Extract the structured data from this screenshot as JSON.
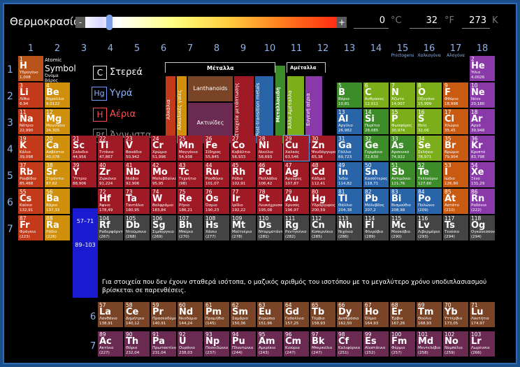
{
  "header": {
    "title": "Θερμοκρασία",
    "minus": "-",
    "plus": "+",
    "kelvin_val": "273",
    "celsius_val": "0",
    "fahrenheit_val": "32",
    "c_unit": "°C",
    "f_unit": "°F",
    "k_unit": "K"
  },
  "groups": [
    "1",
    "2",
    "3",
    "4",
    "5",
    "6",
    "7",
    "8",
    "9",
    "10",
    "11",
    "12",
    "13",
    "14",
    "15",
    "16",
    "17",
    "18"
  ],
  "group_sub": {
    "15": "Pnictogens",
    "16": "Χαλκογόνα",
    "17": "Αλογόνα"
  },
  "periods": [
    "1",
    "2",
    "3",
    "4",
    "5",
    "6",
    "7"
  ],
  "legend": {
    "atomic": "Atomic",
    "symbol": "Symbol",
    "name": "Όνομα",
    "weight": "Βάρος",
    "solid": "Στερεά",
    "liquid": "Υγρά",
    "gas": "Αέρια",
    "unknown": "Άγνωστα",
    "solid_sym": "C",
    "liquid_sym": "Hg",
    "gas_sym": "H",
    "unknown_sym": "Rf"
  },
  "cat_labels": {
    "metals": "Μέταλλα",
    "metalloids": "Μεταλλοειδή",
    "nonmetals": "Αμέταλλα",
    "alkali": "Αλκάλια",
    "alkaline": "Αλκαλικές γαίες",
    "lanthanoids": "Lanthanoids",
    "actinides": "Ακτινίδες",
    "transition": "Στοιχεία μετάπτωσης",
    "post_transition": "Post-transition metals",
    "other_nonmetals": "Άλλα Αμέταλλα",
    "noble": "Ευγενή αέρια"
  },
  "ranges": {
    "lan": "57–71",
    "act": "89–103"
  },
  "note": "Για στοιχεία που δεν έχουν σταθερά ισότοπα, ο μαζικός αριθμός του ισοτόπου με το μεγαλύτερο χρόνο υποδιπλασιασμού βρίσκεται σε παρενθέσεις.",
  "lan_label": "6",
  "act_label": "7",
  "elements": [
    [
      "1",
      "H",
      "Υδρογόνο",
      "1,008",
      1,
      1,
      "h"
    ],
    [
      "2",
      "He",
      "Ήλιο",
      "4.0026",
      1,
      18,
      "nob"
    ],
    [
      "3",
      "Li",
      "Λίθιο",
      "6,94",
      2,
      1,
      "alk"
    ],
    [
      "4",
      "Be",
      "Βηρύλλιο",
      "9,0122",
      2,
      2,
      "ae"
    ],
    [
      "5",
      "B",
      "Βόριο",
      "10,81",
      2,
      13,
      "met"
    ],
    [
      "6",
      "C",
      "Άνθρακας",
      "12,011",
      2,
      14,
      "non"
    ],
    [
      "7",
      "N",
      "Άζωτο",
      "14,007",
      2,
      15,
      "non"
    ],
    [
      "8",
      "O",
      "Οξυγόνο",
      "15,999",
      2,
      16,
      "non"
    ],
    [
      "9",
      "F",
      "Φθόριο",
      "18,998",
      2,
      17,
      "hal"
    ],
    [
      "10",
      "Ne",
      "Νέον",
      "20,180",
      2,
      18,
      "nob"
    ],
    [
      "11",
      "Na",
      "Νάτριο",
      "22,990",
      3,
      1,
      "alk"
    ],
    [
      "12",
      "Mg",
      "Μαγνήσιο",
      "24,305",
      3,
      2,
      "ae"
    ],
    [
      "13",
      "Al",
      "Αργίλιο",
      "26,982",
      3,
      13,
      "ptm"
    ],
    [
      "14",
      "Si",
      "Πυρίτιο",
      "28,085",
      3,
      14,
      "met"
    ],
    [
      "15",
      "P",
      "Φωσφόρος",
      "30,974",
      3,
      15,
      "non"
    ],
    [
      "16",
      "S",
      "Θείο",
      "32,06",
      3,
      16,
      "non"
    ],
    [
      "17",
      "Cl",
      "Χλώριο",
      "35,45",
      3,
      17,
      "hal"
    ],
    [
      "18",
      "Ar",
      "Αργό",
      "39,948",
      3,
      18,
      "nob"
    ],
    [
      "19",
      "K",
      "Κάλιο",
      "39,098",
      4,
      1,
      "alk"
    ],
    [
      "20",
      "Ca",
      "Ασβέστιο",
      "40,078",
      4,
      2,
      "ae"
    ],
    [
      "21",
      "Sc",
      "Σκάνδιο",
      "44,956",
      4,
      3,
      "tm"
    ],
    [
      "22",
      "Ti",
      "Τιτάνιο",
      "47,867",
      4,
      4,
      "tm"
    ],
    [
      "23",
      "V",
      "Βανάδιο",
      "50,942",
      4,
      5,
      "tm"
    ],
    [
      "24",
      "Cr",
      "Χρώμιο",
      "51,996",
      4,
      6,
      "tm"
    ],
    [
      "25",
      "Mn",
      "Μαγγάνιο",
      "54,938",
      4,
      7,
      "tm"
    ],
    [
      "26",
      "Fe",
      "Σίδηρος",
      "55,845",
      4,
      8,
      "tm"
    ],
    [
      "27",
      "Co",
      "Κοβάλτιο",
      "58,933",
      4,
      9,
      "tm"
    ],
    [
      "28",
      "Ni",
      "Νικέλιο",
      "58,693",
      4,
      10,
      "tm"
    ],
    [
      "29",
      "Cu",
      "Χαλκός",
      "63,546",
      4,
      11,
      "tm"
    ],
    [
      "30",
      "Zn",
      "Ψευδάργυρος",
      "65,38",
      4,
      12,
      "tm"
    ],
    [
      "31",
      "Ga",
      "Γάλλιο",
      "69,723",
      4,
      13,
      "ptm"
    ],
    [
      "32",
      "Ge",
      "Γερμάνιο",
      "72,630",
      4,
      14,
      "met"
    ],
    [
      "33",
      "As",
      "Αρσενικό",
      "74,922",
      4,
      15,
      "met"
    ],
    [
      "34",
      "Se",
      "Σελήνιο",
      "78,971",
      4,
      16,
      "non"
    ],
    [
      "35",
      "Br",
      "Βρώμιο",
      "79,904",
      4,
      17,
      "hal"
    ],
    [
      "36",
      "Kr",
      "Κρυπτό",
      "83,798",
      4,
      18,
      "nob"
    ],
    [
      "37",
      "Rb",
      "Ρουβίδιο",
      "85,468",
      5,
      1,
      "alk"
    ],
    [
      "38",
      "Sr",
      "Στρόντιο",
      "87,62",
      5,
      2,
      "ae"
    ],
    [
      "39",
      "Y",
      "Ύττριο",
      "88,906",
      5,
      3,
      "tm"
    ],
    [
      "40",
      "Zr",
      "Ζιρκόνιο",
      "91,224",
      5,
      4,
      "tm"
    ],
    [
      "41",
      "Nb",
      "Νιόβιο",
      "92,906",
      5,
      5,
      "tm"
    ],
    [
      "42",
      "Mo",
      "Μολυβδαίνιο",
      "95,95",
      5,
      6,
      "tm"
    ],
    [
      "43",
      "Tc",
      "Τεχνήτιο",
      "(98)",
      5,
      7,
      "tm"
    ],
    [
      "44",
      "Ru",
      "Ρουθήνιο",
      "101,07",
      5,
      8,
      "tm"
    ],
    [
      "45",
      "Rh",
      "Ρόδιο",
      "102,91",
      5,
      9,
      "tm"
    ],
    [
      "46",
      "Pd",
      "Παλλάδιο",
      "106,42",
      5,
      10,
      "tm"
    ],
    [
      "47",
      "Ag",
      "Άργυρος",
      "107,87",
      5,
      11,
      "tm"
    ],
    [
      "48",
      "Cd",
      "Κάδμιο",
      "112,41",
      5,
      12,
      "tm"
    ],
    [
      "49",
      "In",
      "Ίνδιο",
      "114,82",
      5,
      13,
      "ptm"
    ],
    [
      "50",
      "Sn",
      "Κασσίτερος",
      "118,71",
      5,
      14,
      "ptm"
    ],
    [
      "51",
      "Sb",
      "Αντιμόνιο",
      "121,76",
      5,
      15,
      "met"
    ],
    [
      "52",
      "Te",
      "Τελλούριο",
      "127,60",
      5,
      16,
      "met"
    ],
    [
      "53",
      "I",
      "Ιώδιο",
      "126,90",
      5,
      17,
      "hal"
    ],
    [
      "54",
      "Xe",
      "Ξένο",
      "131,29",
      5,
      18,
      "nob"
    ],
    [
      "55",
      "Cs",
      "Καίσιο",
      "132,91",
      6,
      1,
      "alk"
    ],
    [
      "56",
      "Ba",
      "Βάριο",
      "137,33",
      6,
      2,
      "ae"
    ],
    [
      "72",
      "Hf",
      "Άφνιο",
      "178,49",
      6,
      4,
      "tm"
    ],
    [
      "73",
      "Ta",
      "Ταντάλιο",
      "180,95",
      6,
      5,
      "tm"
    ],
    [
      "74",
      "W",
      "Βολφράμιο",
      "183,84",
      6,
      6,
      "tm"
    ],
    [
      "75",
      "Re",
      "Ρήνιο",
      "186,21",
      6,
      7,
      "tm"
    ],
    [
      "76",
      "Os",
      "Όσμιο",
      "190,23",
      6,
      8,
      "tm"
    ],
    [
      "77",
      "Ir",
      "Ιρίδιο",
      "192,22",
      6,
      9,
      "tm"
    ],
    [
      "78",
      "Pt",
      "Λευκόχρυσος",
      "195,08",
      6,
      10,
      "tm"
    ],
    [
      "79",
      "Au",
      "Χρυσός",
      "196,97",
      6,
      11,
      "tm"
    ],
    [
      "80",
      "Hg",
      "Υδράργυρος",
      "200,59",
      6,
      12,
      "tm"
    ],
    [
      "81",
      "Tl",
      "Θάλλιο",
      "204,38",
      6,
      13,
      "ptm"
    ],
    [
      "82",
      "Pb",
      "Μόλυβδος",
      "207,2",
      6,
      14,
      "ptm"
    ],
    [
      "83",
      "Bi",
      "Βισμούθιο",
      "208,98",
      6,
      15,
      "ptm"
    ],
    [
      "84",
      "Po",
      "Πολώνιο",
      "(209)",
      6,
      16,
      "ptm"
    ],
    [
      "85",
      "At",
      "Αστάτο",
      "(210)",
      6,
      17,
      "hal"
    ],
    [
      "86",
      "Rn",
      "Ραδόνιο",
      "(222)",
      6,
      18,
      "nob"
    ],
    [
      "87",
      "Fr",
      "Φράγκιο",
      "(223)",
      7,
      1,
      "alk"
    ],
    [
      "88",
      "Ra",
      "Ράδιο",
      "(226)",
      7,
      2,
      "ae"
    ],
    [
      "104",
      "Rf",
      "Ραδερφόρντιο",
      "(267)",
      7,
      4,
      "unk"
    ],
    [
      "105",
      "Db",
      "Ντούμπνιο",
      "(268)",
      7,
      5,
      "unk"
    ],
    [
      "106",
      "Sg",
      "Σιμποργκιο",
      "(269)",
      7,
      6,
      "unk"
    ],
    [
      "107",
      "Bh",
      "Μπόριο",
      "(270)",
      7,
      7,
      "unk"
    ],
    [
      "108",
      "Hs",
      "Χάσιο",
      "(277)",
      7,
      8,
      "unk"
    ],
    [
      "109",
      "Mt",
      "Μαϊτνέριο",
      "(278)",
      7,
      9,
      "unk"
    ],
    [
      "110",
      "Ds",
      "Νταρμστάντιο",
      "(281)",
      7,
      10,
      "unk"
    ],
    [
      "111",
      "Rg",
      "Ρεντγκένιο",
      "(282)",
      7,
      11,
      "unk"
    ],
    [
      "112",
      "Cn",
      "Κοπερνίκιο",
      "(285)",
      7,
      12,
      "unk"
    ],
    [
      "113",
      "Nh",
      "Νιχόνιο",
      "(286)",
      7,
      13,
      "unk"
    ],
    [
      "114",
      "Fl",
      "Φλερόβιο",
      "(289)",
      7,
      14,
      "unk"
    ],
    [
      "115",
      "Mc",
      "Μοσκόβιο",
      "(290)",
      7,
      15,
      "unk"
    ],
    [
      "116",
      "Lv",
      "Λιβερμόριο",
      "(293)",
      7,
      16,
      "unk"
    ],
    [
      "117",
      "Ts",
      "Τενέσιο",
      "(294)",
      7,
      17,
      "unk"
    ],
    [
      "118",
      "Og",
      "Ογκανεσσον",
      "(294)",
      7,
      18,
      "unk"
    ]
  ],
  "lanthanides": [
    [
      "57",
      "La",
      "Λανθάνιο",
      "138,91"
    ],
    [
      "58",
      "Ce",
      "Δημήτριο",
      "140,12"
    ],
    [
      "59",
      "Pr",
      "Πρασεοδύμιο",
      "140,91"
    ],
    [
      "60",
      "Nd",
      "Νεοδύμιο",
      "144,24"
    ],
    [
      "61",
      "Pm",
      "Προμήθιο",
      "(145)"
    ],
    [
      "62",
      "Sm",
      "Σαμάριο",
      "150,36"
    ],
    [
      "63",
      "Eu",
      "Ευρώπιο",
      "151,96"
    ],
    [
      "64",
      "Gd",
      "Γαδολίνιο",
      "157,25"
    ],
    [
      "65",
      "Tb",
      "Τέρβιο",
      "158,93"
    ],
    [
      "66",
      "Dy",
      "Δυσπρόσιο",
      "162,50"
    ],
    [
      "67",
      "Ho",
      "Όλμιο",
      "164,93"
    ],
    [
      "68",
      "Er",
      "Έρβιο",
      "167,26"
    ],
    [
      "69",
      "Tm",
      "Θούλιο",
      "168,93"
    ],
    [
      "70",
      "Yb",
      "Υττέρβιο",
      "173,05"
    ],
    [
      "71",
      "Lu",
      "Λουτήτιο",
      "174,97"
    ]
  ],
  "actinides": [
    [
      "89",
      "Ac",
      "Ακτίνιο",
      "(227)"
    ],
    [
      "90",
      "Th",
      "Θόριο",
      "232,04"
    ],
    [
      "91",
      "Pa",
      "Πρωτακτίνιο",
      "231,04"
    ],
    [
      "92",
      "U",
      "Ουράνιο",
      "238,03"
    ],
    [
      "93",
      "Np",
      "Ποσειδώνιο",
      "(237)"
    ],
    [
      "94",
      "Pu",
      "Πλουτώνιο",
      "(244)"
    ],
    [
      "95",
      "Am",
      "Αμερίκιο",
      "(243)"
    ],
    [
      "96",
      "Cm",
      "Κιούριο",
      "(247)"
    ],
    [
      "97",
      "Bk",
      "Μπερκέλιο",
      "(247)"
    ],
    [
      "98",
      "Cf",
      "Καλιφόρνιο",
      "(251)"
    ],
    [
      "99",
      "Es",
      "Αϊνστάινιο",
      "(252)"
    ],
    [
      "100",
      "Fm",
      "Φέρμιο",
      "(257)"
    ],
    [
      "101",
      "Md",
      "Μεντελέβιο",
      "(258)"
    ],
    [
      "102",
      "No",
      "Νομπέλιο",
      "(259)"
    ],
    [
      "103",
      "Lr",
      "Λωρένσιο",
      "(266)"
    ]
  ],
  "colors": {
    "h": "#b8541a",
    "alk": "#c33a1a",
    "ae": "#d0900b",
    "tm": "#a01a26",
    "ptm": "#2a64a8",
    "met": "#3d8c2a",
    "non": "#7cae1a",
    "hal": "#c85a12",
    "nob": "#8a3aa8",
    "unk": "#444444",
    "lan": "#7a4426",
    "act": "#6b2a52"
  }
}
